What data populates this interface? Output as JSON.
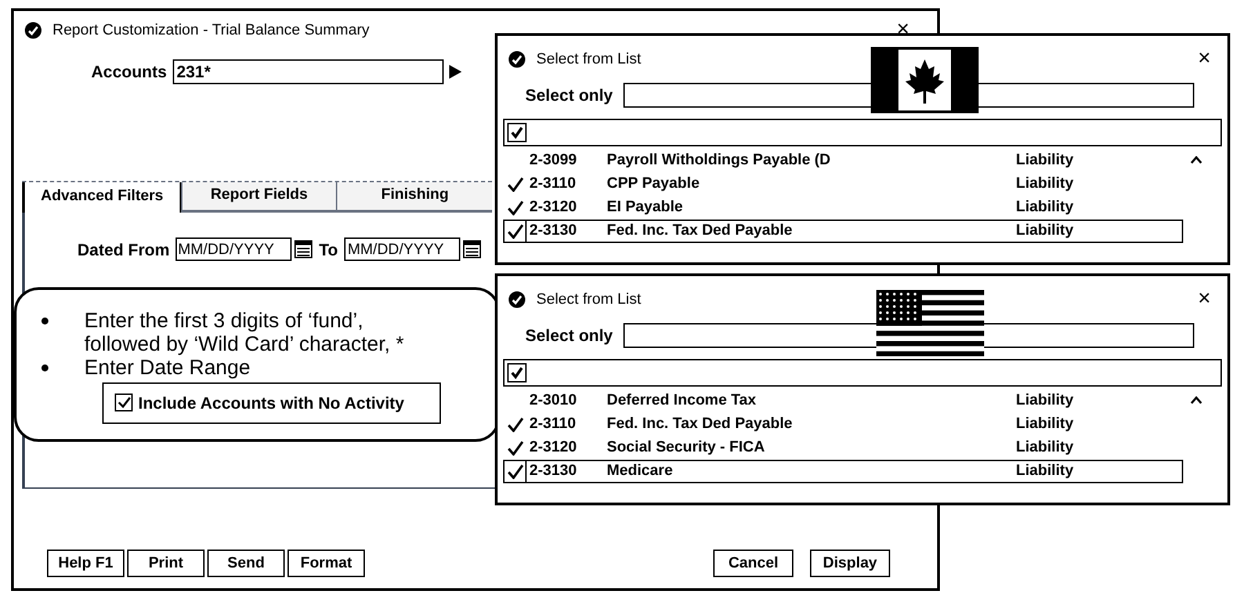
{
  "main_window": {
    "title": "Report Customization - Trial Balance Summary",
    "close": "×",
    "accounts": {
      "label": "Accounts",
      "value": "231*"
    },
    "tabs": [
      {
        "label": "Advanced Filters",
        "selected": true
      },
      {
        "label": "Report Fields",
        "selected": false
      },
      {
        "label": "Finishing",
        "selected": false
      }
    ],
    "dated_from": {
      "label": "Dated From",
      "placeholder": "MM/DD/YYYY"
    },
    "dated_to": {
      "label": "To",
      "placeholder": "MM/DD/YYYY"
    },
    "callout": {
      "bullets": [
        "Enter the first 3 digits of ‘fund’, followed by ‘Wild Card’ character, *",
        "Enter Date Range"
      ]
    },
    "include_no_activity": {
      "label": "Include Accounts with No Activity",
      "checked": true
    },
    "left_buttons": [
      "Help F1",
      "Print",
      "Send",
      "Format"
    ],
    "right_buttons": [
      "Cancel",
      "Display"
    ]
  },
  "popups": [
    {
      "title": "Select from List",
      "close": "×",
      "select_only_label": "Select only",
      "select_all_checked": true,
      "rows": [
        {
          "code": "2-3099",
          "name": "Payroll Witholdings Payable (D",
          "type": "Liability",
          "checked": false,
          "selected": false
        },
        {
          "code": "2-3110",
          "name": "CPP Payable",
          "type": "Liability",
          "checked": true,
          "selected": false
        },
        {
          "code": "2-3120",
          "name": "EI Payable",
          "type": "Liability",
          "checked": true,
          "selected": false
        },
        {
          "code": "2-3130",
          "name": "Fed. Inc. Tax Ded Payable",
          "type": "Liability",
          "checked": true,
          "selected": true
        }
      ]
    },
    {
      "title": "Select from List",
      "close": "×",
      "select_only_label": "Select only",
      "select_all_checked": true,
      "rows": [
        {
          "code": "2-3010",
          "name": "Deferred Income Tax",
          "type": "Liability",
          "checked": false,
          "selected": false
        },
        {
          "code": "2-3110",
          "name": "Fed. Inc. Tax Ded Payable",
          "type": "Liability",
          "checked": true,
          "selected": false
        },
        {
          "code": "2-3120",
          "name": "Social Security - FICA",
          "type": "Liability",
          "checked": true,
          "selected": false
        },
        {
          "code": "2-3130",
          "name": "Medicare",
          "type": "Liability",
          "checked": true,
          "selected": true
        }
      ]
    }
  ]
}
